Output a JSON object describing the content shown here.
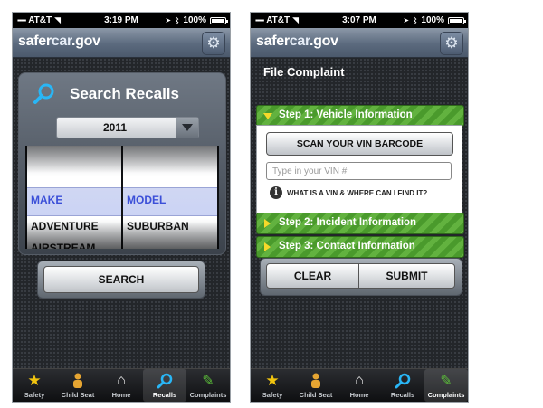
{
  "left": {
    "status": {
      "carrier": "AT&T",
      "time": "3:19 PM",
      "battery": "100%"
    },
    "header": {
      "logo_safer": "safer",
      "logo_car": "car",
      "logo_gov": ".gov"
    },
    "search": {
      "title": "Search Recalls",
      "year": "2011",
      "make_header": "MAKE",
      "model_header": "MODEL",
      "make_items": [
        "ADVENTURE",
        "AIRSTREAM"
      ],
      "model_items": [
        "SUBURBAN"
      ],
      "button": "SEARCH"
    },
    "tabs": [
      {
        "label": "Safety",
        "icon": "star-icon",
        "active": false
      },
      {
        "label": "Child Seat",
        "icon": "child-seat-icon",
        "active": false
      },
      {
        "label": "Home",
        "icon": "home-icon",
        "active": false
      },
      {
        "label": "Recalls",
        "icon": "magnifier-icon",
        "active": true
      },
      {
        "label": "Complaints",
        "icon": "pencil-icon",
        "active": false
      }
    ]
  },
  "right": {
    "status": {
      "carrier": "AT&T",
      "time": "3:07 PM",
      "battery": "100%"
    },
    "header": {
      "logo_safer": "safer",
      "logo_car": "car",
      "logo_gov": ".gov"
    },
    "complaint": {
      "title": "File Complaint",
      "step1": "Step 1: Vehicle Information",
      "scan_button": "SCAN YOUR VIN BARCODE",
      "vin_placeholder": "Type in your VIN #",
      "vin_help": "WHAT IS A VIN & WHERE CAN I FIND IT?",
      "step2": "Step 2: Incident Information",
      "step3": "Step 3: Contact Information",
      "clear_button": "CLEAR",
      "submit_button": "SUBMIT"
    },
    "tabs": [
      {
        "label": "Safety",
        "icon": "star-icon",
        "active": false
      },
      {
        "label": "Child Seat",
        "icon": "child-seat-icon",
        "active": false
      },
      {
        "label": "Home",
        "icon": "home-icon",
        "active": false
      },
      {
        "label": "Recalls",
        "icon": "magnifier-icon",
        "active": false
      },
      {
        "label": "Complaints",
        "icon": "pencil-icon",
        "active": true
      }
    ]
  },
  "colors": {
    "accent_blue": "#3b4fd8",
    "step_green": "#4a9a2c",
    "arrow_yellow": "#f5d92a",
    "search_icon": "#29b6f6"
  }
}
